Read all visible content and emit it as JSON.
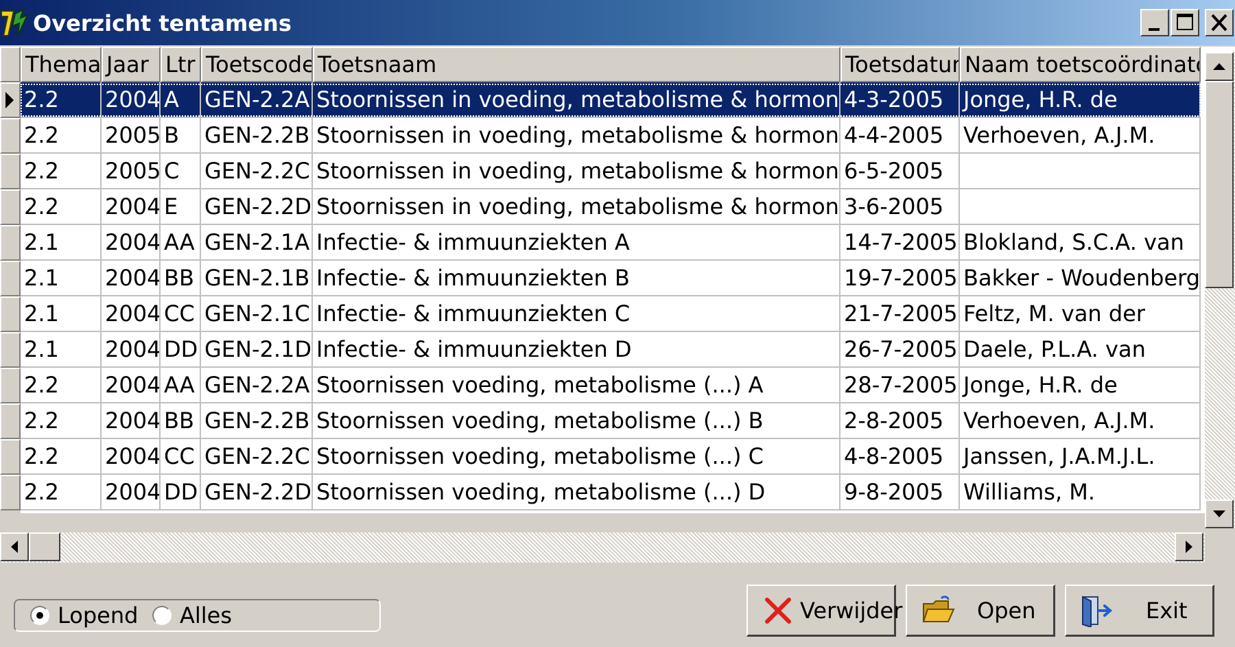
{
  "window": {
    "title": "Overzicht tentamens",
    "controls": [
      "minimize",
      "maximize",
      "close"
    ]
  },
  "grid": {
    "columns": [
      "Thema",
      "Jaar",
      "Ltr",
      "Toetscode",
      "Toetsnaam",
      "Toetsdatum",
      "Naam toetscoördinator"
    ],
    "selected_row": 0,
    "rows": [
      [
        "2.2",
        "2004",
        "A",
        "GEN-2.2A",
        "Stoornissen in voeding, metabolisme & hormonale regula",
        "4-3-2005",
        "Jonge, H.R. de"
      ],
      [
        "2.2",
        "2005",
        "B",
        "GEN-2.2B",
        "Stoornissen in voeding, metabolisme & hormonale regula",
        "4-4-2005",
        "Verhoeven, A.J.M."
      ],
      [
        "2.2",
        "2005",
        "C",
        "GEN-2.2C",
        "Stoornissen in voeding, metabolisme & hormonale regula",
        "6-5-2005",
        ""
      ],
      [
        "2.2",
        "2004",
        "E",
        "GEN-2.2D",
        "Stoornissen in voeding, metabolisme & hormonale regula",
        "3-6-2005",
        ""
      ],
      [
        "2.1",
        "2004",
        "AA",
        "GEN-2.1A",
        "Infectie- & immuunziekten A",
        "14-7-2005",
        "Blokland, S.C.A. van"
      ],
      [
        "2.1",
        "2004",
        "BB",
        "GEN-2.1B",
        "Infectie- & immuunziekten B",
        "19-7-2005",
        "Bakker - Woudenberg, I.A"
      ],
      [
        "2.1",
        "2004",
        "CC",
        "GEN-2.1C",
        "Infectie- & immuunziekten C",
        "21-7-2005",
        "Feltz, M. van der"
      ],
      [
        "2.1",
        "2004",
        "DD",
        "GEN-2.1D",
        "Infectie- & immuunziekten D",
        "26-7-2005",
        "Daele, P.L.A. van"
      ],
      [
        "2.2",
        "2004",
        "AA",
        "GEN-2.2A",
        "Stoornissen voeding, metabolisme (...) A",
        "28-7-2005",
        "Jonge, H.R. de"
      ],
      [
        "2.2",
        "2004",
        "BB",
        "GEN-2.2B",
        "Stoornissen voeding, metabolisme (...) B",
        "2-8-2005",
        "Verhoeven, A.J.M."
      ],
      [
        "2.2",
        "2004",
        "CC",
        "GEN-2.2C",
        "Stoornissen voeding, metabolisme (...) C",
        "4-8-2005",
        "Janssen, J.A.M.J.L."
      ],
      [
        "2.2",
        "2004",
        "DD",
        "GEN-2.2D",
        "Stoornissen voeding, metabolisme (...) D",
        "9-8-2005",
        "Williams, M."
      ]
    ]
  },
  "filter": {
    "options": [
      "Lopend",
      "Alles"
    ],
    "selected": "Lopend"
  },
  "buttons": {
    "delete_label": "Verwijder",
    "open_label": "Open",
    "exit_label": "Exit"
  },
  "colors": {
    "selection": "#0a246a",
    "title_gradient_start": "#0a246a",
    "title_gradient_end": "#a6caf0",
    "delete_icon": "#e0201a",
    "folder_icon": "#f0c030",
    "exit_icon": "#2060d0"
  },
  "icons": {
    "app": "app-icon",
    "row_indicator": "row-indicator-arrow-icon",
    "delete": "red-x-icon",
    "open": "folder-open-icon",
    "exit": "exit-door-icon"
  }
}
